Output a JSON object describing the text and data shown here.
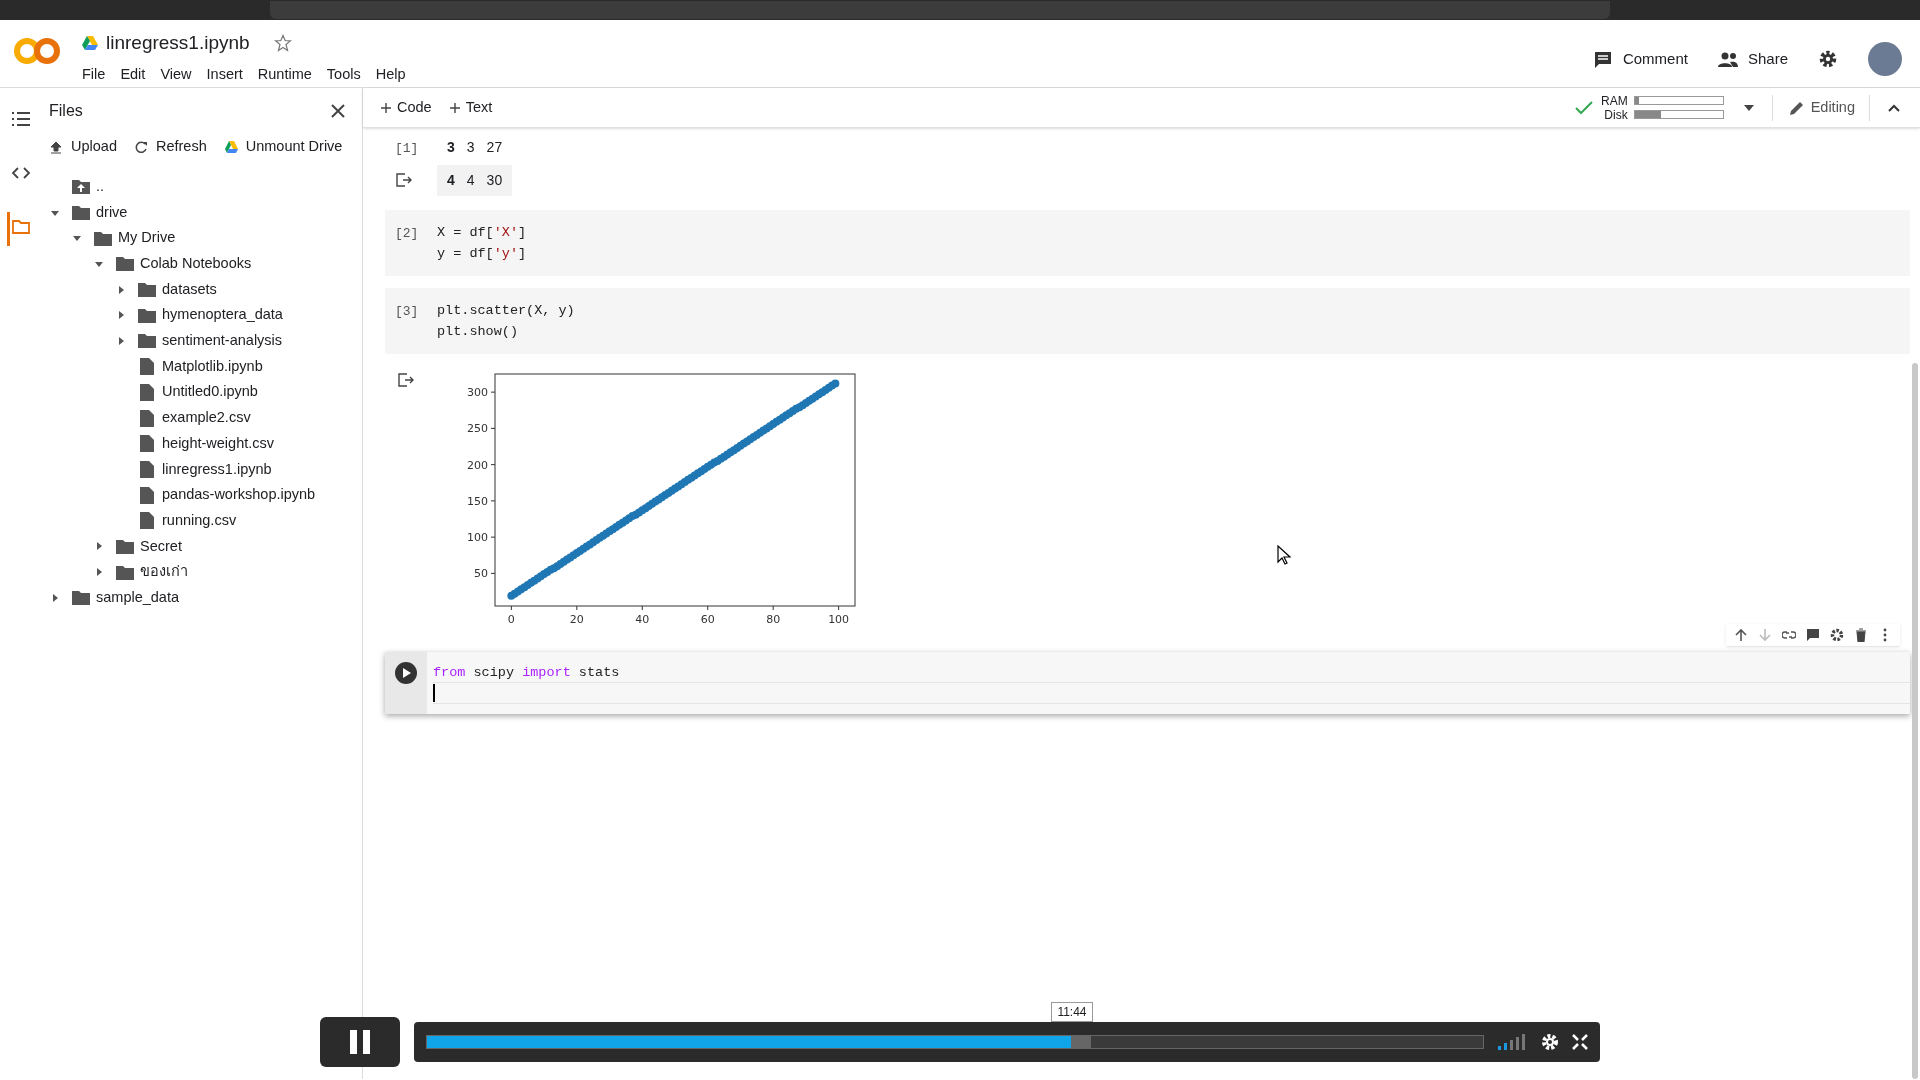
{
  "app": {
    "title": "linregress1.ipynb",
    "menu": [
      "File",
      "Edit",
      "View",
      "Insert",
      "Runtime",
      "Tools",
      "Help"
    ],
    "header_actions": [
      {
        "kind": "comment",
        "label": "Comment"
      },
      {
        "kind": "share",
        "label": "Share"
      }
    ]
  },
  "toolbar": {
    "add_buttons": [
      "Code",
      "Text"
    ],
    "connected": true,
    "resources": [
      {
        "label": "RAM",
        "level": 0.05
      },
      {
        "label": "Disk",
        "level": 0.3
      }
    ],
    "mode": "Editing"
  },
  "sidebar": {
    "tabs": [
      {
        "kind": "toc",
        "selected": false
      },
      {
        "kind": "code",
        "selected": false
      },
      {
        "kind": "files",
        "selected": true
      }
    ],
    "title": "Files",
    "actions": [
      {
        "kind": "upload",
        "label": "Upload"
      },
      {
        "kind": "refresh",
        "label": "Refresh"
      },
      {
        "kind": "drive",
        "label": "Unmount Drive"
      }
    ],
    "tree": [
      {
        "kind": "parent",
        "name": ".."
      },
      {
        "kind": "folder",
        "name": "drive",
        "expanded": true,
        "children": [
          {
            "kind": "folder",
            "name": "My Drive",
            "expanded": true,
            "children": [
              {
                "kind": "folder",
                "name": "Colab Notebooks",
                "expanded": true,
                "children": [
                  {
                    "kind": "folder",
                    "name": "datasets",
                    "expanded": false
                  },
                  {
                    "kind": "folder",
                    "name": "hymenoptera_data",
                    "expanded": false
                  },
                  {
                    "kind": "folder",
                    "name": "sentiment-analysis",
                    "expanded": false
                  },
                  {
                    "kind": "file",
                    "name": "Matplotlib.ipynb"
                  },
                  {
                    "kind": "file",
                    "name": "Untitled0.ipynb"
                  },
                  {
                    "kind": "file",
                    "name": "example2.csv"
                  },
                  {
                    "kind": "file",
                    "name": "height-weight.csv"
                  },
                  {
                    "kind": "file",
                    "name": "linregress1.ipynb"
                  },
                  {
                    "kind": "file",
                    "name": "pandas-workshop.ipynb"
                  },
                  {
                    "kind": "file",
                    "name": "running.csv"
                  }
                ]
              },
              {
                "kind": "folder",
                "name": "Secret",
                "expanded": false
              },
              {
                "kind": "folder",
                "name": "ของเก่า",
                "expanded": false
              }
            ]
          }
        ]
      },
      {
        "kind": "folder",
        "name": "sample_data",
        "expanded": false
      }
    ]
  },
  "cells": [
    {
      "kind": "table_output",
      "prompt": "[1]",
      "rows": [
        {
          "cells": [
            "3",
            "3",
            "27"
          ],
          "highlighted": false
        },
        {
          "cells": [
            "4",
            "4",
            "30"
          ],
          "highlighted": true
        }
      ]
    },
    {
      "kind": "code",
      "prompt": "[2]",
      "active": false,
      "lines": [
        [
          {
            "kind": "plain",
            "text": "X = df["
          },
          {
            "kind": "string",
            "text": "'X'"
          },
          {
            "kind": "plain",
            "text": "]"
          }
        ],
        [
          {
            "kind": "plain",
            "text": "y = df["
          },
          {
            "kind": "string",
            "text": "'y'"
          },
          {
            "kind": "plain",
            "text": "]"
          }
        ]
      ]
    },
    {
      "kind": "code",
      "prompt": "[3]",
      "active": false,
      "lines": [
        [
          {
            "kind": "plain",
            "text": "plt.scatter(X, y)"
          }
        ],
        [
          {
            "kind": "plain",
            "text": "plt.show()"
          }
        ]
      ]
    },
    {
      "kind": "plot_output",
      "chart_data": {
        "type": "scatter",
        "xlim": [
          -5,
          105
        ],
        "ylim": [
          5,
          325
        ],
        "xticks": [
          0,
          20,
          40,
          60,
          80,
          100
        ],
        "yticks": [
          50,
          100,
          150,
          200,
          250,
          300
        ],
        "series": [
          {
            "color": "#1f77b4",
            "x": [
              0,
              1,
              2,
              3,
              4,
              5,
              6,
              7,
              8,
              9,
              10,
              11,
              12,
              13,
              14,
              15,
              16,
              17,
              18,
              19,
              20,
              21,
              22,
              23,
              24,
              25,
              26,
              27,
              28,
              29,
              30,
              31,
              32,
              33,
              34,
              35,
              36,
              37,
              38,
              39,
              40,
              41,
              42,
              43,
              44,
              45,
              46,
              47,
              48,
              49,
              50,
              51,
              52,
              53,
              54,
              55,
              56,
              57,
              58,
              59,
              60,
              61,
              62,
              63,
              64,
              65,
              66,
              67,
              68,
              69,
              70,
              71,
              72,
              73,
              74,
              75,
              76,
              77,
              78,
              79,
              80,
              81,
              82,
              83,
              84,
              85,
              86,
              87,
              88,
              89,
              90,
              91,
              92,
              93,
              94,
              95,
              96,
              97,
              98,
              99
            ],
            "values": [
              19,
              22,
              25,
              28,
              31,
              34,
              37,
              40,
              43,
              46,
              49,
              52,
              55,
              57,
              60,
              63,
              66,
              69,
              72,
              75,
              78,
              81,
              84,
              87,
              90,
              93,
              96,
              99,
              102,
              105,
              108,
              111,
              114,
              117,
              120,
              123,
              126,
              129,
              131,
              134,
              137,
              140,
              143,
              146,
              149,
              152,
              155,
              158,
              161,
              164,
              167,
              170,
              173,
              176,
              179,
              182,
              185,
              188,
              191,
              194,
              197,
              200,
              203,
              205,
              208,
              211,
              214,
              217,
              220,
              223,
              226,
              229,
              232,
              235,
              238,
              241,
              244,
              247,
              250,
              253,
              256,
              259,
              262,
              265,
              268,
              271,
              274,
              277,
              279,
              282,
              285,
              288,
              291,
              294,
              297,
              300,
              303,
              306,
              309,
              312
            ]
          }
        ]
      }
    },
    {
      "kind": "code",
      "active": true,
      "lines": [
        [
          {
            "kind": "keyword",
            "text": "from"
          },
          {
            "kind": "plain",
            "text": " scipy "
          },
          {
            "kind": "keyword",
            "text": "import"
          },
          {
            "kind": "plain",
            "text": " stats"
          }
        ]
      ]
    }
  ],
  "player": {
    "playing": true,
    "level": 0.61,
    "time": "11:44"
  }
}
